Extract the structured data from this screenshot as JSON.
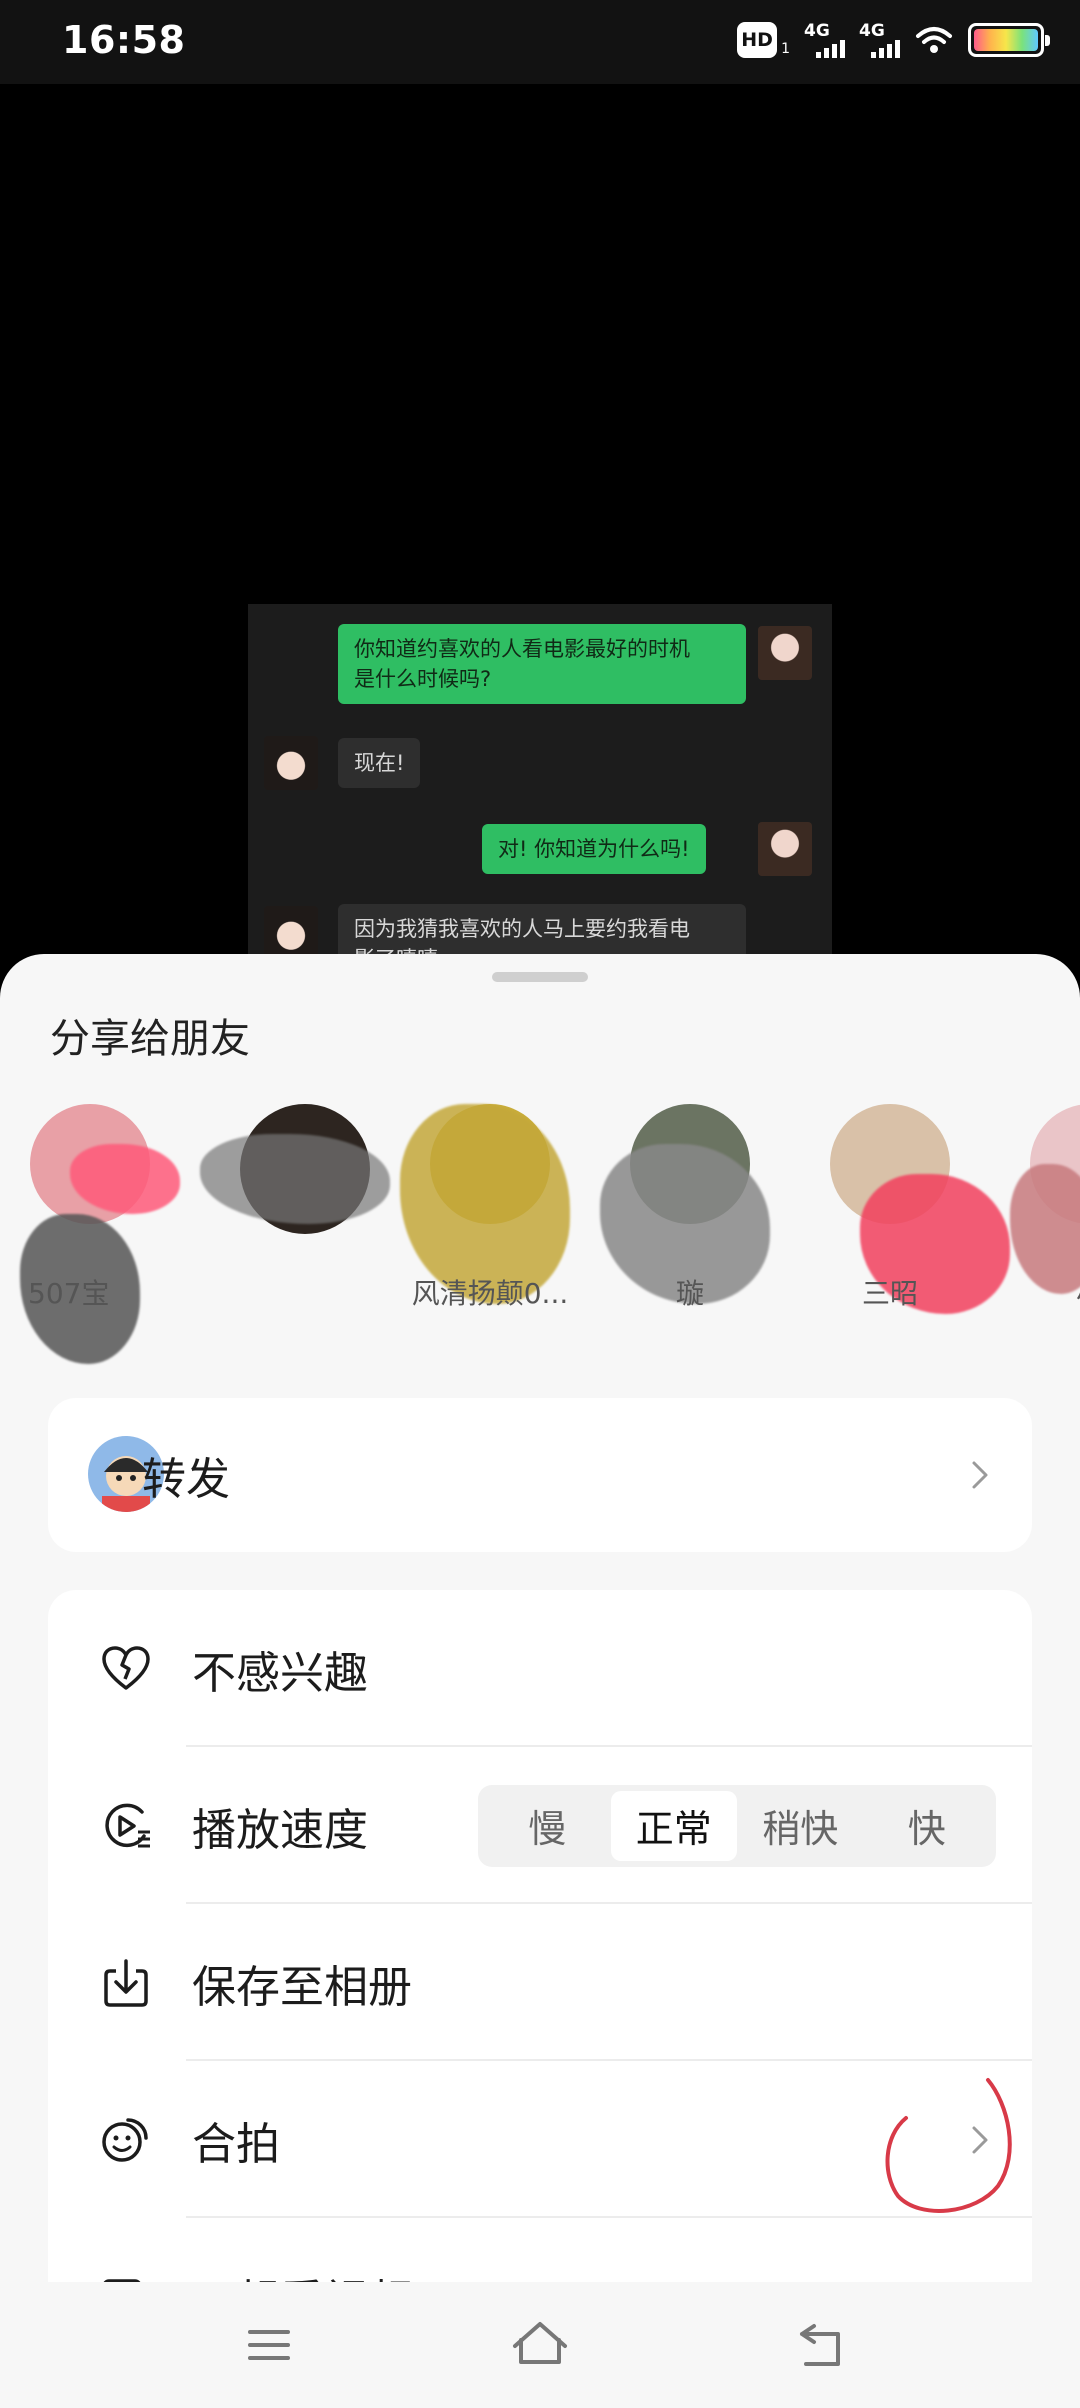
{
  "status_bar": {
    "time": "16:58",
    "hd_badge": "HD",
    "hd_sub": "1",
    "network_1": "4G",
    "network_2": "4G"
  },
  "video_chat": {
    "messages": [
      {
        "side": "right",
        "text_line1": "你知道约喜欢的人看电影最好的时机",
        "text_line2": "是什么时候吗?"
      },
      {
        "side": "left",
        "text": "现在!"
      },
      {
        "side": "right",
        "text": "对! 你知道为什么吗!"
      },
      {
        "side": "left",
        "text_line1": "因为我猜我喜欢的人马上要约我看电",
        "text_line2": "影了嘻嘻"
      }
    ]
  },
  "share_sheet": {
    "title": "分享给朋友",
    "friends": [
      {
        "name": "507宝",
        "avatar_color": "#e8a0a6"
      },
      {
        "name": "",
        "avatar_color": "#2d2520"
      },
      {
        "name": "风清扬颠0...",
        "avatar_color": "#c9ad3a"
      },
      {
        "name": "璇",
        "avatar_color": "#6b7462"
      },
      {
        "name": "三昭",
        "avatar_color": "#d9c1a8"
      },
      {
        "name": "小",
        "avatar_color": "#eac5c8"
      }
    ],
    "forward": {
      "label": "转发",
      "icon": "chevron-right-icon"
    },
    "options": [
      {
        "label": "不感兴趣",
        "icon": "broken-heart-icon"
      },
      {
        "label": "播放速度",
        "icon": "playback-speed-icon"
      },
      {
        "label": "保存至相册",
        "icon": "download-icon"
      },
      {
        "label": "合拍",
        "icon": "duet-icon"
      },
      {
        "label": "一起看视频",
        "icon": "watch-together-icon"
      }
    ],
    "speed": {
      "options": [
        "慢",
        "正常",
        "稍快",
        "快"
      ],
      "selected": "正常"
    }
  },
  "colors": {
    "sheet_bg": "#f7f7f7",
    "card_bg": "#ffffff",
    "chat_green": "#2fbe63",
    "annotation_red": "#d83a48"
  },
  "nav_bar": {
    "menu": "menu-icon",
    "home": "home-icon",
    "back": "back-icon"
  }
}
